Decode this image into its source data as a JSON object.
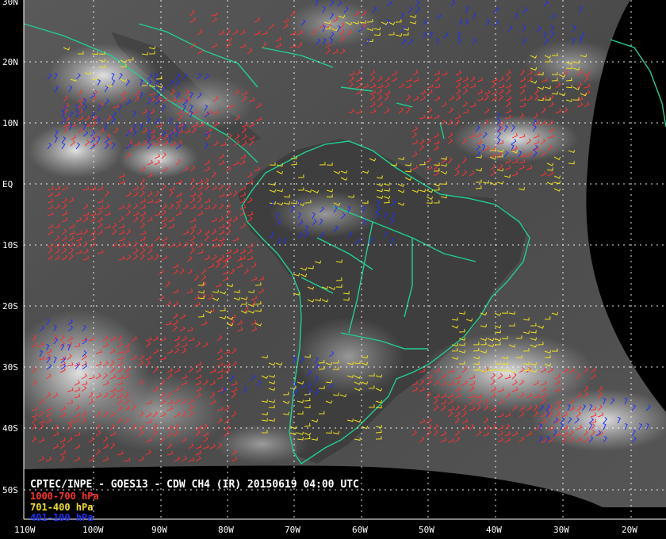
{
  "caption": "CPTEC/INPE - GOES13 - CDW CH4 (IR) 20150619 04:00 UTC",
  "legend": [
    {
      "label": "1000-700 hPa",
      "color": "#ff3030"
    },
    {
      "label": "701-400 hPa",
      "color": "#f0e020"
    },
    {
      "label": "401-100 hPa",
      "color": "#2030ff"
    }
  ],
  "lat_labels": [
    "30N",
    "20N",
    "10N",
    "EQ",
    "10S",
    "20S",
    "30S",
    "40S",
    "50S"
  ],
  "lon_labels": [
    "110W",
    "100W",
    "90W",
    "80W",
    "70W",
    "60W",
    "50W",
    "40W",
    "30W",
    "20W"
  ],
  "colors": {
    "coastline": "#20d090",
    "grid": "#ffffff",
    "space": "#000000"
  }
}
